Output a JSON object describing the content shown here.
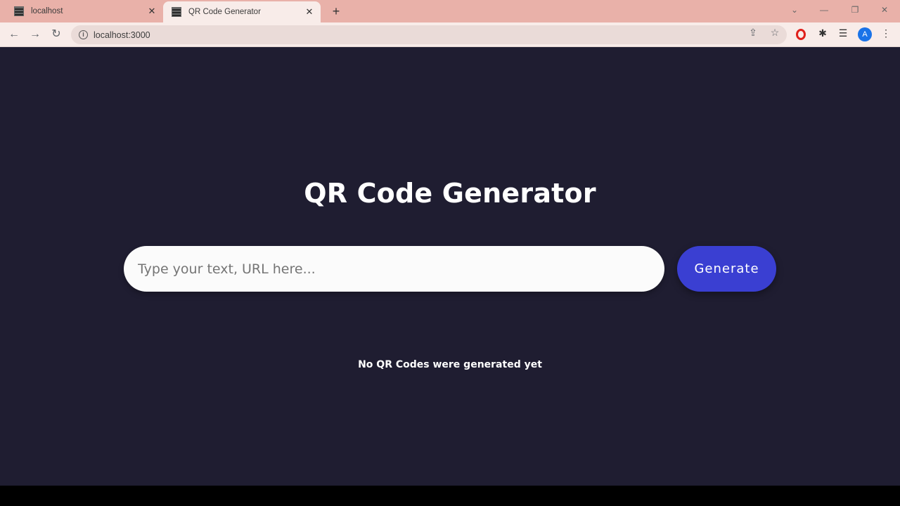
{
  "browser": {
    "tabs": [
      {
        "title": "localhost",
        "active": false
      },
      {
        "title": "QR Code Generator",
        "active": true
      }
    ],
    "new_tab_icon": "plus-icon",
    "address": "localhost:3000",
    "profile_initial": "A"
  },
  "app": {
    "title": "QR Code Generator",
    "input": {
      "placeholder": "Type your text, URL here...",
      "value": ""
    },
    "generate_label": "Generate",
    "empty_message": "No QR Codes were generated yet"
  },
  "colors": {
    "page_background": "#1f1d31",
    "button_accent": "#3a3fd2",
    "tabbar": "#e9b1a9"
  }
}
